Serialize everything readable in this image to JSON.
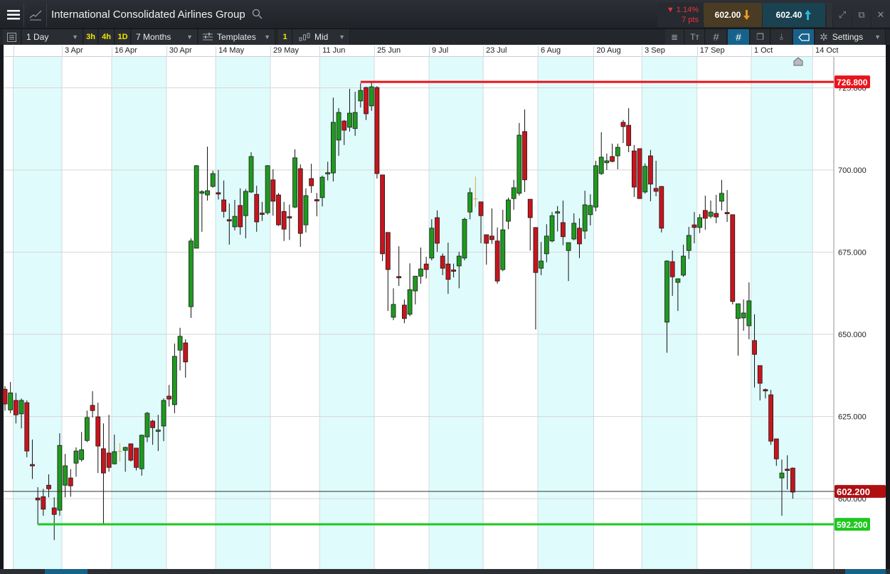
{
  "header": {
    "title": "International Consolidated Airlines Group",
    "change_pct": "▼ 1.14%",
    "change_pts": "7 pts",
    "sell_price": "602.00",
    "buy_price": "602.40"
  },
  "toolbar": {
    "interval": "1 Day",
    "quick_intervals": [
      "3h",
      "4h",
      "1D"
    ],
    "range": "7 Months",
    "templates": "Templates",
    "count": "1",
    "price_type": "Mid",
    "settings": "Settings"
  },
  "colors": {
    "up": "#1e9a1e",
    "down": "#c8141c",
    "flat": "#d9a640",
    "resistance": "#e8141c",
    "support": "#1ec81e",
    "current": "#b00f10",
    "band": "#e0fbfc"
  },
  "chart_data": {
    "type": "candlestick",
    "instrument": "International Consolidated Airlines Group",
    "ylim": [
      578.6,
      734.4
    ],
    "y_ticks": [
      "725.000",
      "700.000",
      "675.000",
      "650.000",
      "625.000",
      "600.000"
    ],
    "y_tick_values": [
      725,
      700,
      675,
      650,
      625,
      600
    ],
    "x_ticks": [
      {
        "label": "",
        "index": 2
      },
      {
        "label": "3 Apr",
        "index": 10.9
      },
      {
        "label": "16 Apr",
        "index": 20
      },
      {
        "label": "30 Apr",
        "index": 30
      },
      {
        "label": "14 May",
        "index": 39
      },
      {
        "label": "29 May",
        "index": 49
      },
      {
        "label": "11 Jun",
        "index": 58
      },
      {
        "label": "25 Jun",
        "index": 68
      },
      {
        "label": "9 Jul",
        "index": 78
      },
      {
        "label": "23 Jul",
        "index": 87.9
      },
      {
        "label": "6 Aug",
        "index": 97.9
      },
      {
        "label": "20 Aug",
        "index": 108.1
      },
      {
        "label": "3 Sep",
        "index": 116.9
      },
      {
        "label": "17 Sep",
        "index": 127
      },
      {
        "label": "1 Oct",
        "index": 136.9
      },
      {
        "label": "14 Oct",
        "index": 148.1
      }
    ],
    "ohlc": [
      [
        633.3,
        634.2,
        626.8,
        628.8
      ],
      [
        627,
        635.5,
        626,
        632.2
      ],
      [
        629.9,
        632.2,
        622.9,
        625.5
      ],
      [
        625.8,
        630.5,
        621.4,
        629.9
      ],
      [
        629.2,
        629.9,
        612.6,
        614.5
      ],
      [
        610.4,
        618,
        606,
        610.0
      ],
      [
        600.2,
        603.5,
        592.2,
        599.6
      ],
      [
        600.6,
        603,
        594.8,
        596.8
      ],
      [
        604.1,
        607.4,
        600.4,
        603
      ],
      [
        597.2,
        600.4,
        587.4,
        595.2
      ],
      [
        596.5,
        619.9,
        594.8,
        616.2
      ],
      [
        604.1,
        613.6,
        600.4,
        610
      ],
      [
        606.3,
        609,
        600.6,
        603.9
      ],
      [
        610.8,
        615.6,
        606.7,
        614.5
      ],
      [
        611.9,
        620.3,
        611.3,
        614.9
      ],
      [
        617.7,
        626.8,
        617.2,
        624.7
      ],
      [
        628.4,
        632.7,
        624.7,
        626.8
      ],
      [
        624.9,
        629.2,
        607.8,
        616
      ],
      [
        615.2,
        622.9,
        592.2,
        607.8
      ],
      [
        613.9,
        625.5,
        608.2,
        609.5
      ],
      [
        610.6,
        619.5,
        610.4,
        614.3
      ],
      [
        614.4,
        616.9,
        611.3,
        614.4
      ],
      [
        614.7,
        615.8,
        608.2,
        615.6
      ],
      [
        616.7,
        616.7,
        611.3,
        611.7
      ],
      [
        615.4,
        615.4,
        608.6,
        609.5
      ],
      [
        609.1,
        619.5,
        607,
        619.3
      ],
      [
        618.8,
        626.4,
        617.2,
        626
      ],
      [
        623.6,
        624,
        616.4,
        621.6
      ],
      [
        620.7,
        625.5,
        614.5,
        620.9
      ],
      [
        622.1,
        630.5,
        617.5,
        629.9
      ],
      [
        631.2,
        634.6,
        628,
        630.3
      ],
      [
        628.6,
        647.2,
        626,
        643.3
      ],
      [
        645.2,
        652,
        639,
        649.4
      ],
      [
        647.4,
        648.5,
        636.8,
        641.6
      ],
      [
        658.4,
        679.2,
        655,
        678.4
      ],
      [
        676.2,
        701.5,
        676.2,
        701.3
      ],
      [
        692.9,
        693.9,
        681.2,
        693.4
      ],
      [
        692.4,
        707.1,
        690.7,
        693.7
      ],
      [
        695,
        699.8,
        694.6,
        698.9
      ],
      [
        693.1,
        700,
        691,
        692.9
      ],
      [
        690.9,
        696.8,
        685.5,
        687.4
      ],
      [
        684.9,
        689.8,
        677.3,
        684.7
      ],
      [
        682.7,
        690.9,
        681.6,
        685.9
      ],
      [
        689.2,
        694.4,
        680.3,
        682.7
      ],
      [
        686.1,
        694.2,
        679.2,
        693.5
      ],
      [
        693.3,
        705.4,
        693,
        704.1
      ],
      [
        692.6,
        695.2,
        681.2,
        684.2
      ],
      [
        686.9,
        690.3,
        684.5,
        686.7
      ],
      [
        687,
        701.5,
        686.4,
        701.3
      ],
      [
        697,
        700.2,
        686.1,
        690.5
      ],
      [
        692.4,
        693,
        683,
        683.3
      ],
      [
        687.4,
        690.3,
        678.4,
        682
      ],
      [
        685.8,
        689.5,
        678.7,
        685.6
      ],
      [
        688.7,
        706.3,
        688.4,
        703.7
      ],
      [
        700.4,
        701.7,
        676.6,
        680.7
      ],
      [
        683.3,
        694.4,
        681,
        692.2
      ],
      [
        697.4,
        701.9,
        693,
        695.2
      ],
      [
        691,
        693,
        685.9,
        690.8
      ],
      [
        691.6,
        698.3,
        688.9,
        697.8
      ],
      [
        699,
        702.5,
        696.8,
        699.2
      ],
      [
        699.1,
        722,
        696.5,
        714.5
      ],
      [
        709.1,
        718.8,
        704.3,
        717.5
      ],
      [
        714.9,
        715.2,
        707.6,
        712.1
      ],
      [
        713,
        724.7,
        711.7,
        717.3
      ],
      [
        712.6,
        723.8,
        710.4,
        717.5
      ],
      [
        721,
        726.4,
        719,
        724.2
      ],
      [
        725.1,
        725.3,
        715.2,
        717.1
      ],
      [
        719.5,
        726.8,
        718,
        725.3
      ],
      [
        725.1,
        725.5,
        697.4,
        698.9
      ],
      [
        698.5,
        698.5,
        672.3,
        674.5
      ],
      [
        681,
        681,
        657.1,
        669.7
      ],
      [
        655.2,
        664,
        654.3,
        659.1
      ],
      [
        667.6,
        676.8,
        664.7,
        667.4
      ],
      [
        658.9,
        660.6,
        653.4,
        654.8
      ],
      [
        656.1,
        671.6,
        655.5,
        663.6
      ],
      [
        663.2,
        667.7,
        659.1,
        667.7
      ],
      [
        667.7,
        676.4,
        665.4,
        669.9
      ],
      [
        671.4,
        673.6,
        667,
        669.7
      ],
      [
        673.2,
        685,
        672.5,
        682.3
      ],
      [
        685.5,
        687.7,
        675.1,
        677.7
      ],
      [
        673.8,
        674.6,
        668,
        670.1
      ],
      [
        671.4,
        677.9,
        662.3,
        666.7
      ],
      [
        669.6,
        671.5,
        667.3,
        669.4
      ],
      [
        670.8,
        675.1,
        664,
        673.8
      ],
      [
        673.2,
        685.5,
        672.5,
        685
      ],
      [
        687.2,
        694.6,
        685,
        693.1
      ],
      [
        691.2,
        698,
        688.7,
        691.2
      ],
      [
        690.3,
        690.3,
        677.7,
        686.1
      ],
      [
        680.3,
        680.3,
        671.2,
        677.7
      ],
      [
        679.9,
        688.3,
        677.5,
        678.8
      ],
      [
        678.4,
        682.5,
        665.4,
        666.2
      ],
      [
        669.7,
        687.9,
        669.2,
        681.8
      ],
      [
        684.4,
        691.6,
        682,
        690.9
      ],
      [
        691.3,
        697,
        687.9,
        694.6
      ],
      [
        692.9,
        714.3,
        692.2,
        710.6
      ],
      [
        711.7,
        718.4,
        693.3,
        697
      ],
      [
        691.1,
        691.1,
        675.5,
        685.5
      ],
      [
        682.5,
        682.5,
        651.5,
        668.8
      ],
      [
        670.1,
        678.1,
        668,
        672.3
      ],
      [
        674.5,
        683.5,
        671.9,
        679.9
      ],
      [
        678.4,
        687.2,
        678,
        686.1
      ],
      [
        687.1,
        689,
        681.3,
        687.3
      ],
      [
        684,
        690.7,
        677.1,
        679.7
      ],
      [
        675.5,
        677.9,
        666.2,
        677.9
      ],
      [
        679,
        686.8,
        678.6,
        683.8
      ],
      [
        682.3,
        685.3,
        673.2,
        677.5
      ],
      [
        681.4,
        693.7,
        679,
        689.4
      ],
      [
        686.4,
        692.6,
        683.1,
        689.2
      ],
      [
        688.7,
        702.8,
        687.4,
        701.3
      ],
      [
        698.9,
        711.5,
        698.5,
        703.9
      ],
      [
        702.2,
        705,
        700,
        702.8
      ],
      [
        704.1,
        708,
        702.3,
        702.6
      ],
      [
        704.3,
        708,
        700.2,
        706.9
      ],
      [
        714.5,
        715.2,
        708.2,
        713.2
      ],
      [
        713.6,
        718.8,
        705.4,
        707.4
      ],
      [
        705.8,
        707.6,
        691.8,
        694.8
      ],
      [
        706.5,
        706.5,
        691.3,
        691.3
      ],
      [
        693.3,
        702,
        692.8,
        701.1
      ],
      [
        704.3,
        706.1,
        690.5,
        695.7
      ],
      [
        694.4,
        702.8,
        692,
        693.5
      ],
      [
        695,
        695,
        681,
        682.3
      ],
      [
        653.7,
        672.5,
        644.4,
        672.3
      ],
      [
        672.1,
        675.5,
        661.7,
        667.5
      ],
      [
        665.8,
        666.9,
        657.1,
        666.9
      ],
      [
        668,
        677.3,
        667.5,
        673.8
      ],
      [
        675.5,
        682.7,
        672.9,
        680.1
      ],
      [
        683.3,
        687.2,
        677.7,
        682.5
      ],
      [
        682.5,
        686.6,
        680.8,
        685.5
      ],
      [
        687.7,
        692.2,
        681.8,
        685.3
      ],
      [
        685.9,
        690.7,
        685.3,
        687.2
      ],
      [
        686.8,
        692.4,
        683.8,
        685.7
      ],
      [
        690.5,
        697,
        687.7,
        692.9
      ],
      [
        687.1,
        693.9,
        684.2,
        686.9
      ],
      [
        686.4,
        686.4,
        659.1,
        660
      ],
      [
        654.8,
        659.3,
        643.5,
        659.3
      ],
      [
        655,
        660.6,
        651.1,
        656.5
      ],
      [
        652.6,
        665.8,
        648.5,
        660.2
      ],
      [
        648.1,
        656.1,
        633.8,
        643.9
      ],
      [
        640.5,
        640.5,
        629.9,
        635.1
      ],
      [
        633.2,
        633.5,
        630.5,
        633
      ],
      [
        631.6,
        633.1,
        616.4,
        617.5
      ],
      [
        618.2,
        618.2,
        610,
        612.1
      ],
      [
        606.3,
        611.9,
        594.8,
        607.8
      ],
      [
        609,
        613.2,
        602.8,
        608.8
      ],
      [
        609.3,
        609.5,
        600,
        602
      ]
    ],
    "levels": [
      {
        "name": "resistance",
        "value": 726.8,
        "label": "726.800",
        "start_index": 65
      },
      {
        "name": "current",
        "value": 602.2,
        "label": "602.200",
        "start_index": -1
      },
      {
        "name": "support",
        "value": 592.2,
        "label": "592.200",
        "start_index": 6
      }
    ]
  }
}
